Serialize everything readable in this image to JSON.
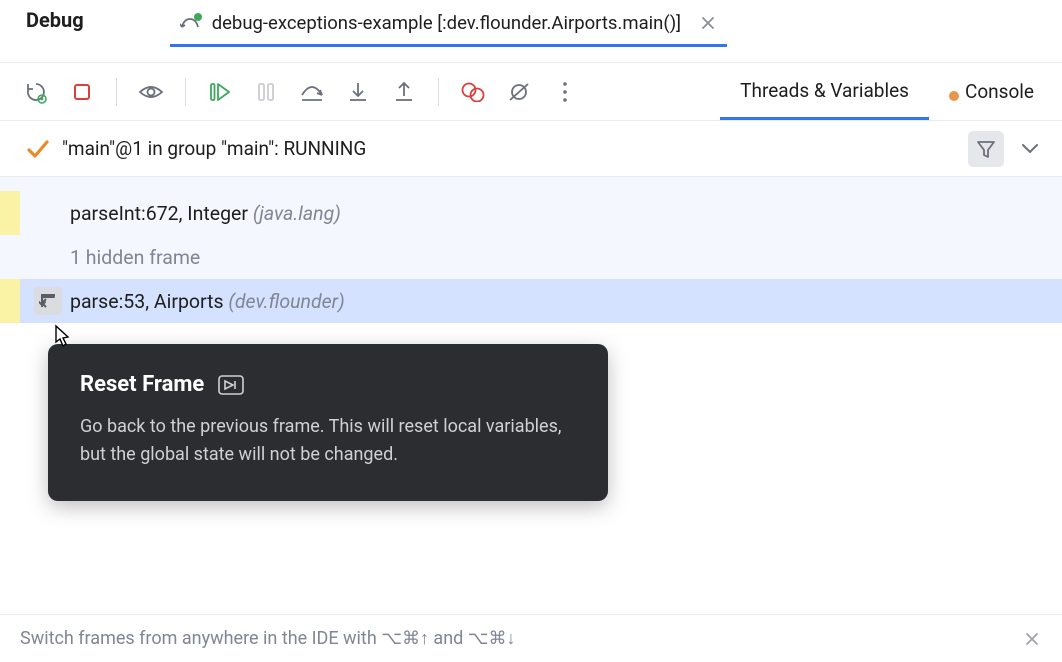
{
  "header": {
    "title": "Debug",
    "tab": {
      "label": "debug-exceptions-example [:dev.flounder.Airports.main()]",
      "icon": "runner-icon"
    }
  },
  "toolbar": {
    "icons": {
      "rerun": "rerun-icon",
      "stop": "stop-icon",
      "view": "view-icon",
      "resume": "resume-icon",
      "pause": "pause-icon",
      "step_over": "step-over-icon",
      "step_into": "step-into-icon",
      "step_out": "step-out-icon",
      "breakpoints": "breakpoints-icon",
      "mute_bp": "mute-breakpoints-icon",
      "more": "more-icon"
    },
    "tabs": {
      "threads": "Threads & Variables",
      "console": "Console"
    }
  },
  "thread": {
    "status": "\"main\"@1 in group \"main\": RUNNING"
  },
  "frames": [
    {
      "method": "parseInt:672, Integer",
      "package": "(java.lang)",
      "hasGutter": true,
      "selected": false
    },
    {
      "method": "1 hidden frame",
      "package": "",
      "hidden": true,
      "hasGutter": false,
      "selected": false
    },
    {
      "method": "parse:53, Airports",
      "package": "(dev.flounder)",
      "hasGutter": true,
      "selected": true,
      "showReset": true
    }
  ],
  "tooltip": {
    "title": "Reset Frame",
    "body": "Go back to the previous frame. This will reset local variables, but the global state will not be changed."
  },
  "tip": {
    "text": "Switch frames from anywhere in the IDE with ⌥⌘↑ and ⌥⌘↓"
  }
}
